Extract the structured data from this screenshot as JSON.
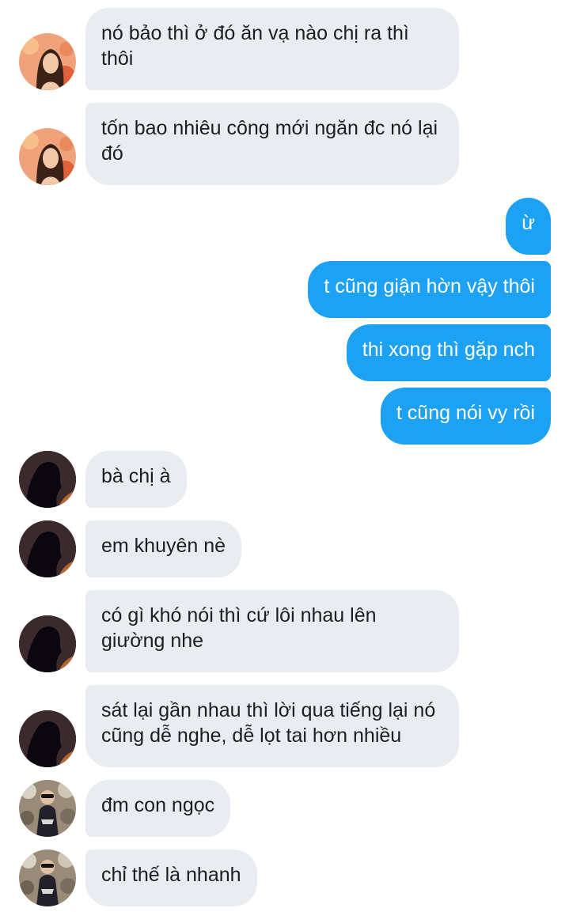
{
  "chat": {
    "colors": {
      "incoming_bubble": "#e9ecf0",
      "outgoing_bubble": "#1da1f2",
      "incoming_text": "#1b1f23",
      "outgoing_text": "#ffffff"
    },
    "messages": [
      {
        "direction": "incoming",
        "avatar": "avatar-woman-flowers",
        "text": "nó bảo thì ở đó ăn vạ nào chị ra thì thôi"
      },
      {
        "direction": "incoming",
        "avatar": "avatar-woman-flowers",
        "text": "tốn bao nhiêu công mới ngăn đc nó lại đó"
      },
      {
        "direction": "outgoing",
        "text": "ừ"
      },
      {
        "direction": "outgoing",
        "text": "t cũng giận hờn vậy thôi"
      },
      {
        "direction": "outgoing",
        "text": "thi xong thì gặp nch"
      },
      {
        "direction": "outgoing",
        "text": "t cũng nói vy rồi"
      },
      {
        "direction": "incoming",
        "avatar": "avatar-silhouette",
        "text": "bà chị à"
      },
      {
        "direction": "incoming",
        "avatar": "avatar-silhouette",
        "text": "em khuyên nè"
      },
      {
        "direction": "incoming",
        "avatar": "avatar-silhouette",
        "text": "có gì khó nói thì cứ lôi nhau lên giường nhe"
      },
      {
        "direction": "incoming",
        "avatar": "avatar-silhouette",
        "text": "sát lại gần nhau thì lời qua tiếng lại nó cũng dễ nghe, dễ lọt tai hơn nhiều"
      },
      {
        "direction": "incoming",
        "avatar": "avatar-person-sunglasses",
        "text": "đm con ngọc"
      },
      {
        "direction": "incoming",
        "avatar": "avatar-person-sunglasses",
        "text": "chỉ thế là nhanh"
      }
    ]
  }
}
